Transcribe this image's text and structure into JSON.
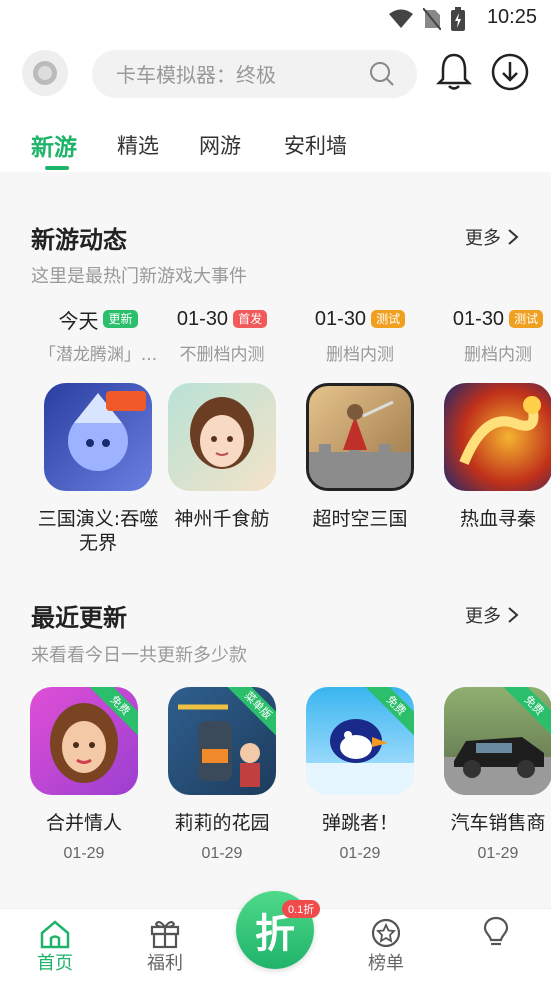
{
  "status_bar": {
    "time": "10:25"
  },
  "search": {
    "placeholder": "卡车模拟器：终极"
  },
  "tabs": [
    "新游",
    "精选",
    "网游",
    "安利墙"
  ],
  "new_games": {
    "title": "新游动态",
    "subtitle": "这里是最热门新游戏大事件",
    "more_label": "更多",
    "items": [
      {
        "date": "今天",
        "badge": "更新",
        "badge_color": "#2bbf6c",
        "status": "「潜龙腾渊」...",
        "name": "三国演义:吞噬无界",
        "icon": "hero-warrior-icon",
        "icon_bg": "#3a4fb5"
      },
      {
        "date": "01-30",
        "badge": "首发",
        "badge_color": "#f05a5a",
        "status": "不删档内测",
        "name": "神州千食舫",
        "icon": "girl-portrait-icon",
        "icon_bg": "#9fd3c7"
      },
      {
        "date": "01-30",
        "badge": "测试",
        "badge_color": "#f0a020",
        "status": "删档内测",
        "name": "超时空三国",
        "icon": "general-on-wall-icon",
        "icon_bg": "#c9a06a"
      },
      {
        "date": "01-30",
        "badge": "测试",
        "badge_color": "#f0a020",
        "status": "删档内测",
        "name": "热血寻秦",
        "icon": "golden-dragon-icon",
        "icon_bg": "#1b2a6e"
      }
    ]
  },
  "recent_updates": {
    "title": "最近更新",
    "subtitle": "来看看今日一共更新多少款",
    "more_label": "更多",
    "items": [
      {
        "ribbon": "免费",
        "name": "合并情人",
        "date": "01-29",
        "icon": "woman-portrait-icon",
        "icon_bg": "#c24fd6"
      },
      {
        "ribbon": "菜单版",
        "name": "莉莉的花园",
        "date": "01-29",
        "icon": "boiler-girl-icon",
        "icon_bg": "#2f5f8f"
      },
      {
        "ribbon": "免费",
        "name": "弹跳者！",
        "date": "01-29",
        "icon": "penguin-icon",
        "icon_bg": "#4ec3f0"
      },
      {
        "ribbon": "免费",
        "name": "汽车销售商",
        "date": "01-29",
        "icon": "sports-car-icon",
        "icon_bg": "#6f8a5a"
      }
    ]
  },
  "nav": {
    "home": "首页",
    "welfare": "福利",
    "center": "折",
    "center_badge": "0.1折",
    "ranking": "榜单"
  }
}
